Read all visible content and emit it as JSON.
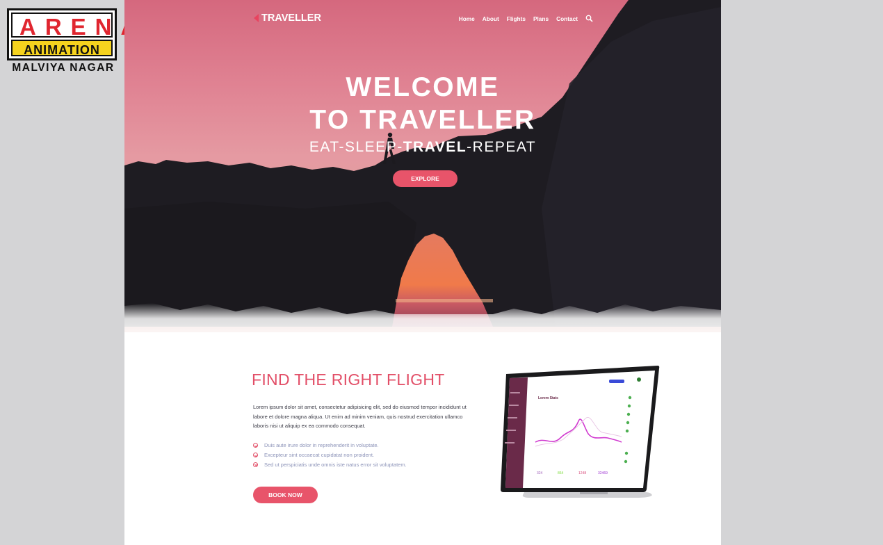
{
  "brand": {
    "top": "ARENA",
    "middle": "ANIMATION",
    "bottom": "MALVIYA NAGAR"
  },
  "nav": {
    "logo": "TRAVELLER",
    "items": [
      "Home",
      "About",
      "Flights",
      "Plans",
      "Contact"
    ],
    "search_icon": "search-icon"
  },
  "hero": {
    "title_line1": "WELCOME",
    "title_line2": "TO TRAVELLER",
    "tagline_pre": "EAT-SLEEP-",
    "tagline_bold": "TRAVEL",
    "tagline_post": "-REPEAT",
    "cta": "EXPLORE"
  },
  "section": {
    "title": "FIND THE RIGHT FLIGHT",
    "lead": "Lorem ipsum dolor sit amet, consectetur adipisicing elit, sed do eiusmod tempor incididunt ut labore et dolore magna aliqua. Ut enim ad minim veniam, quis nostrud exercitation ullamco laboris nisi ut aliquip ex ea commodo consequat.",
    "features": [
      "Duis aute irure dolor in reprehenderit in voluptate.",
      "Excepteur sint occaecat cupidatat non proident.",
      "Sed ut perspiciatis unde omnis iste natus error sit voluptatem."
    ],
    "cta": "BOOK NOW"
  },
  "dashboard": {
    "heading": "Lorem Stats",
    "stats": [
      "324",
      "864",
      "1248",
      "32469"
    ]
  },
  "colors": {
    "accent": "#e8546a",
    "title": "#e24e67",
    "feature_text": "#8c93b8",
    "sidebar": "#6a2a49"
  }
}
